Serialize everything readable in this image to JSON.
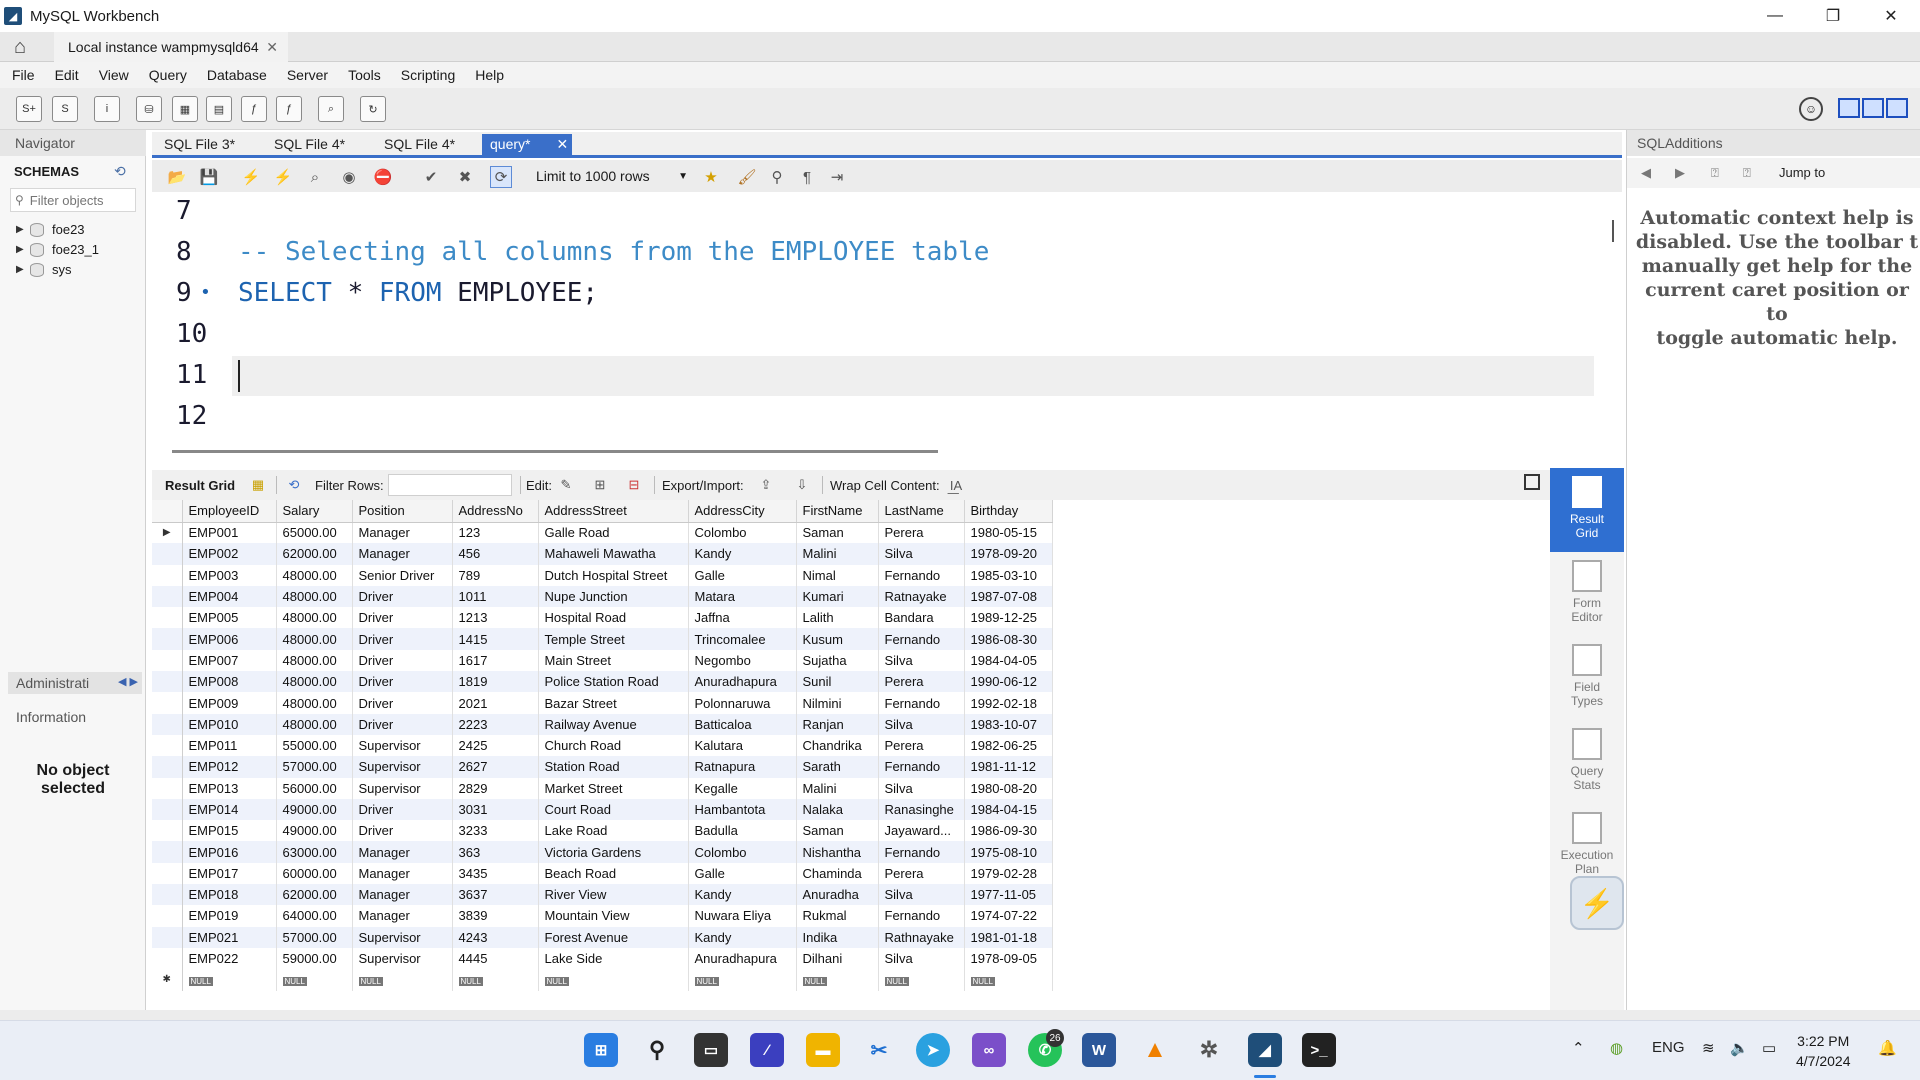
{
  "window": {
    "title": "MySQL Workbench",
    "controls": [
      "—",
      "❐",
      "✕"
    ]
  },
  "connection_tab": {
    "label": "Local instance wampmysqld64",
    "close": "✕"
  },
  "menu": [
    "File",
    "Edit",
    "View",
    "Query",
    "Database",
    "Server",
    "Tools",
    "Scripting",
    "Help"
  ],
  "main_toolbar_icons": [
    "new-sql-tab-icon",
    "open-sql-script-icon",
    "open-inspector-icon",
    "create-schema-icon",
    "create-table-icon",
    "create-view-icon",
    "create-procedure-icon",
    "create-function-icon",
    "search-table-data-icon",
    "reconnect-icon"
  ],
  "navigator": {
    "title": "Navigator",
    "schemas_label": "SCHEMAS",
    "filter_placeholder": "Filter objects",
    "schemas": [
      "foe23",
      "foe23_1",
      "sys"
    ],
    "administration_label": "Administrati",
    "information_label": "Information",
    "no_object_line1": "No object",
    "no_object_line2": "selected"
  },
  "editor_tabs": [
    {
      "label": "SQL File 3*"
    },
    {
      "label": "SQL File 4*"
    },
    {
      "label": "SQL File 4*"
    },
    {
      "label": "query*",
      "active": true
    }
  ],
  "editor_toolbar": {
    "limit_label": "Limit to 1000 rows"
  },
  "editor": {
    "lines": [
      {
        "num": "7",
        "comment": "",
        "kw1": "",
        "mid": "",
        "kw2": "",
        "rest": ""
      },
      {
        "num": "8",
        "comment": "-- Selecting all columns from the EMPLOYEE table"
      },
      {
        "num": "9",
        "kw1": "SELECT",
        "mid": " * ",
        "kw2": "FROM",
        "rest": " EMPLOYEE;"
      },
      {
        "num": "10"
      },
      {
        "num": "11"
      },
      {
        "num": "12"
      }
    ]
  },
  "result_toolbar": {
    "result_grid": "Result Grid",
    "filter_rows": "Filter Rows:",
    "edit": "Edit:",
    "export_import": "Export/Import:",
    "wrap_cell": "Wrap Cell Content:"
  },
  "result_columns": [
    "EmployeeID",
    "Salary",
    "Position",
    "AddressNo",
    "AddressStreet",
    "AddressCity",
    "FirstName",
    "LastName",
    "Birthday"
  ],
  "result_rows": [
    [
      "EMP001",
      "65000.00",
      "Manager",
      "123",
      "Galle Road",
      "Colombo",
      "Saman",
      "Perera",
      "1980-05-15"
    ],
    [
      "EMP002",
      "62000.00",
      "Manager",
      "456",
      "Mahaweli Mawatha",
      "Kandy",
      "Malini",
      "Silva",
      "1978-09-20"
    ],
    [
      "EMP003",
      "48000.00",
      "Senior Driver",
      "789",
      "Dutch Hospital Street",
      "Galle",
      "Nimal",
      "Fernando",
      "1985-03-10"
    ],
    [
      "EMP004",
      "48000.00",
      "Driver",
      "1011",
      "Nupe Junction",
      "Matara",
      "Kumari",
      "Ratnayake",
      "1987-07-08"
    ],
    [
      "EMP005",
      "48000.00",
      "Driver",
      "1213",
      "Hospital Road",
      "Jaffna",
      "Lalith",
      "Bandara",
      "1989-12-25"
    ],
    [
      "EMP006",
      "48000.00",
      "Driver",
      "1415",
      "Temple Street",
      "Trincomalee",
      "Kusum",
      "Fernando",
      "1986-08-30"
    ],
    [
      "EMP007",
      "48000.00",
      "Driver",
      "1617",
      "Main Street",
      "Negombo",
      "Sujatha",
      "Silva",
      "1984-04-05"
    ],
    [
      "EMP008",
      "48000.00",
      "Driver",
      "1819",
      "Police Station Road",
      "Anuradhapura",
      "Sunil",
      "Perera",
      "1990-06-12"
    ],
    [
      "EMP009",
      "48000.00",
      "Driver",
      "2021",
      "Bazar Street",
      "Polonnaruwa",
      "Nilmini",
      "Fernando",
      "1992-02-18"
    ],
    [
      "EMP010",
      "48000.00",
      "Driver",
      "2223",
      "Railway Avenue",
      "Batticaloa",
      "Ranjan",
      "Silva",
      "1983-10-07"
    ],
    [
      "EMP011",
      "55000.00",
      "Supervisor",
      "2425",
      "Church Road",
      "Kalutara",
      "Chandrika",
      "Perera",
      "1982-06-25"
    ],
    [
      "EMP012",
      "57000.00",
      "Supervisor",
      "2627",
      "Station Road",
      "Ratnapura",
      "Sarath",
      "Fernando",
      "1981-11-12"
    ],
    [
      "EMP013",
      "56000.00",
      "Supervisor",
      "2829",
      "Market Street",
      "Kegalle",
      "Malini",
      "Silva",
      "1980-08-20"
    ],
    [
      "EMP014",
      "49000.00",
      "Driver",
      "3031",
      "Court Road",
      "Hambantota",
      "Nalaka",
      "Ranasinghe",
      "1984-04-15"
    ],
    [
      "EMP015",
      "49000.00",
      "Driver",
      "3233",
      "Lake Road",
      "Badulla",
      "Saman",
      "Jayaward...",
      "1986-09-30"
    ],
    [
      "EMP016",
      "63000.00",
      "Manager",
      "363",
      "Victoria Gardens",
      "Colombo",
      "Nishantha",
      "Fernando",
      "1975-08-10"
    ],
    [
      "EMP017",
      "60000.00",
      "Manager",
      "3435",
      "Beach Road",
      "Galle",
      "Chaminda",
      "Perera",
      "1979-02-28"
    ],
    [
      "EMP018",
      "62000.00",
      "Manager",
      "3637",
      "River View",
      "Kandy",
      "Anuradha",
      "Silva",
      "1977-11-05"
    ],
    [
      "EMP019",
      "64000.00",
      "Manager",
      "3839",
      "Mountain View",
      "Nuwara Eliya",
      "Rukmal",
      "Fernando",
      "1974-07-22"
    ],
    [
      "EMP021",
      "57000.00",
      "Supervisor",
      "4243",
      "Forest Avenue",
      "Kandy",
      "Indika",
      "Rathnayake",
      "1981-01-18"
    ],
    [
      "EMP022",
      "59000.00",
      "Supervisor",
      "4445",
      "Lake Side",
      "Anuradhapura",
      "Dilhani",
      "Silva",
      "1978-09-05"
    ]
  ],
  "null_label": "NULL",
  "side_panel": [
    {
      "line1": "Result",
      "line2": "Grid",
      "active": true
    },
    {
      "line1": "Form",
      "line2": "Editor"
    },
    {
      "line1": "Field",
      "line2": "Types"
    },
    {
      "line1": "Query",
      "line2": "Stats"
    },
    {
      "line1": "Execution",
      "line2": "Plan"
    }
  ],
  "sql_additions": {
    "title": "SQLAdditions",
    "jump_to": "Jump to",
    "help_lines": [
      "Automatic context help is",
      "disabled. Use the toolbar t",
      "manually get help for the",
      "current caret position or to",
      "toggle automatic help."
    ]
  },
  "taskbar": {
    "whatsapp_badge": "26",
    "lang": "ENG",
    "time": "3:22 PM",
    "date": "4/7/2024"
  }
}
